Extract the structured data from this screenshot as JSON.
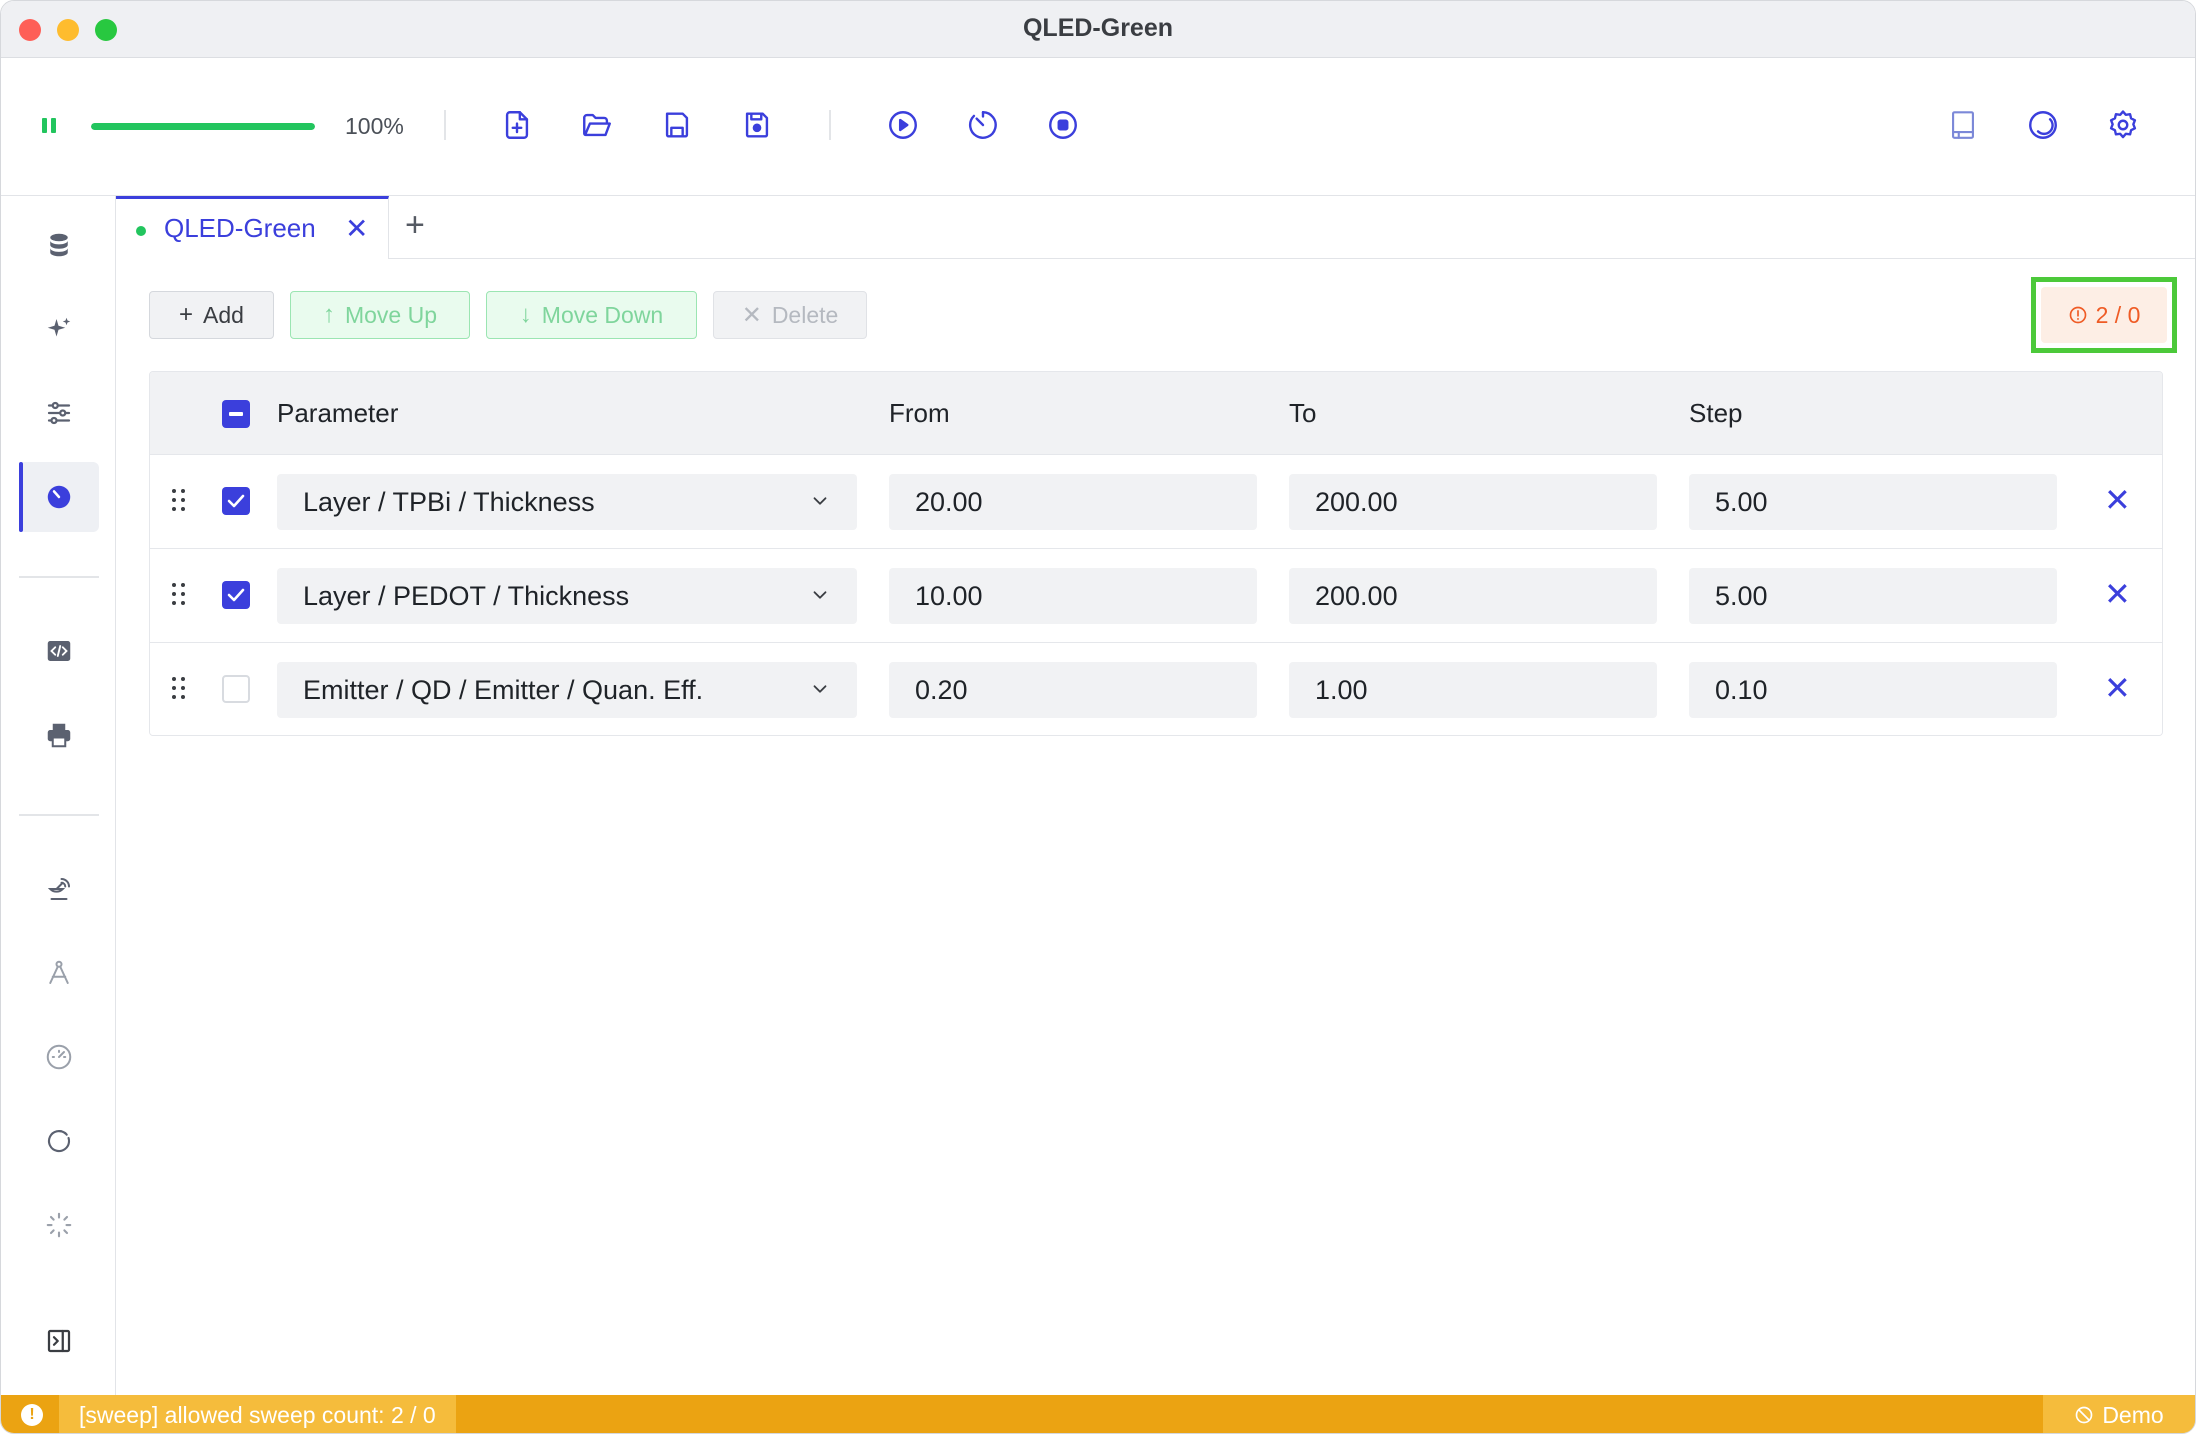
{
  "window": {
    "title": "QLED-Green"
  },
  "toolbar": {
    "progress_percent": 100,
    "progress_text": "100%",
    "icons": [
      "pause-icon",
      "new-file-icon",
      "open-folder-icon",
      "save-icon",
      "save-as-icon",
      "run-icon",
      "timer-icon",
      "stop-icon",
      "book-icon",
      "theme-icon",
      "settings-icon"
    ]
  },
  "sidebar": {
    "icons": [
      "database-icon",
      "sparkles-icon",
      "sliders-icon",
      "sweep-icon",
      "code-icon",
      "printer-icon",
      "satellite-icon",
      "compass-icon",
      "gauge-icon",
      "refresh-icon",
      "loader-icon",
      "panel-toggle-icon"
    ],
    "active": "sweep-icon"
  },
  "tabs": [
    {
      "label": "QLED-Green",
      "active": true,
      "close": "✕"
    }
  ],
  "tab_add": "+",
  "actions": {
    "add": "Add",
    "move_up": "Move Up",
    "move_down": "Move Down",
    "delete": "Delete"
  },
  "warning_badge": "2 / 0",
  "table": {
    "columns": [
      "Parameter",
      "From",
      "To",
      "Step"
    ],
    "rows": [
      {
        "checked": true,
        "parameter": "Layer / TPBi / Thickness",
        "from": "20.00",
        "to": "200.00",
        "step": "5.00"
      },
      {
        "checked": true,
        "parameter": "Layer / PEDOT / Thickness",
        "from": "10.00",
        "to": "200.00",
        "step": "5.00"
      },
      {
        "checked": false,
        "parameter": "Emitter / QD / Emitter / Quan. Eff.",
        "from": "0.20",
        "to": "1.00",
        "step": "0.10"
      }
    ]
  },
  "status": {
    "message": "[sweep] allowed sweep count: 2 / 0",
    "mode": "Demo"
  },
  "colors": {
    "accent": "#3b3fdc",
    "success": "#22c55e",
    "warning": "#eba312",
    "highlight_outline": "#4cc93a",
    "badge_text": "#ef5b25"
  }
}
